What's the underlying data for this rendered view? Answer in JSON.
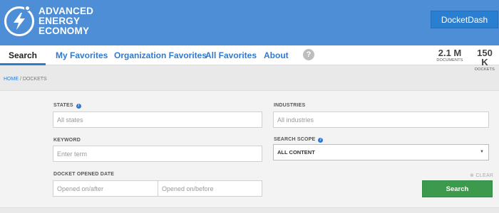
{
  "header": {
    "logo_lines": [
      "Advanced",
      "Energy",
      "Economy"
    ],
    "docketdash_label": "DocketDash"
  },
  "nav": {
    "tabs": [
      {
        "label": "Search",
        "active": true
      },
      {
        "label": "My Favorites",
        "active": false
      },
      {
        "label": "Organization Favorites",
        "active": false
      },
      {
        "label": "All Favorites",
        "active": false
      },
      {
        "label": "About",
        "active": false
      }
    ],
    "help_icon": "?",
    "stats": [
      {
        "value": "2.1 M",
        "label": "DOCUMENTS"
      },
      {
        "value": "150 K",
        "label": "DOCKETS"
      }
    ]
  },
  "breadcrumb": {
    "home": "HOME",
    "separator": "/",
    "current": "DOCKETS"
  },
  "form": {
    "states": {
      "label": "STATES",
      "placeholder": "All states"
    },
    "industries": {
      "label": "INDUSTRIES",
      "placeholder": "All industries"
    },
    "keyword": {
      "label": "KEYWORD",
      "placeholder": "Enter term"
    },
    "search_scope": {
      "label": "SEARCH SCOPE",
      "value": "ALL CONTENT"
    },
    "docket_date": {
      "label": "DOCKET OPENED DATE",
      "after_placeholder": "Opened on/after",
      "before_placeholder": "Opened on/before"
    },
    "clear_label": "CLEAR",
    "search_label": "Search"
  },
  "colors": {
    "header_bg": "#4d8ed6",
    "accent": "#2f7ad0",
    "search_button": "#3b9a4b"
  }
}
